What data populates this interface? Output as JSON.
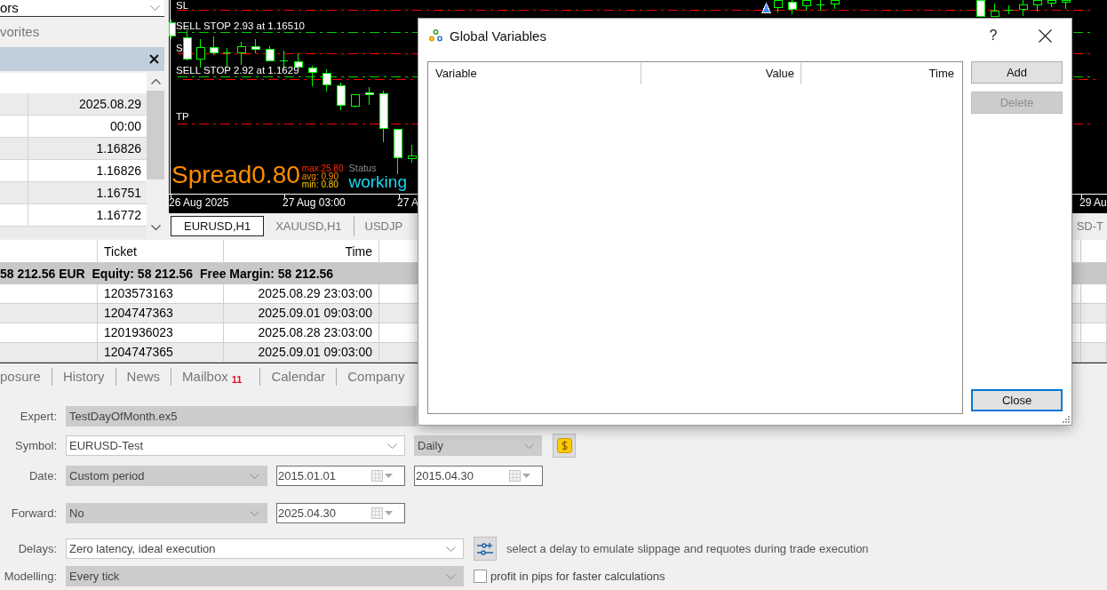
{
  "market_watch": {
    "dropdown": "ors",
    "tab": "vorites",
    "values": [
      "2025.08.29",
      "00:00",
      "1.16826",
      "1.16826",
      "1.16751",
      "1.16772"
    ]
  },
  "chart": {
    "levels": [
      {
        "label": "SL",
        "color": "#ff0000"
      },
      {
        "label": "SELL STOP 2.93 at 1.16510",
        "color": "#00d000"
      },
      {
        "label": "S",
        "color": "#ff0000"
      },
      {
        "label": "SELL STOP 2.92 at 1.1629",
        "color": "#00d000"
      },
      {
        "label": "TP",
        "color": "#ff0000"
      }
    ],
    "spread": {
      "label": "Spread",
      "value": "0.80",
      "max": "max:25.80",
      "avg": "avg: 0.90",
      "min": "min: 0.80",
      "status_label": "Status",
      "status": "working"
    },
    "time_axis": [
      "26 Aug 2025",
      "27 Aug 03:00",
      "27 A",
      "29 Au"
    ]
  },
  "chart_tabs": [
    {
      "label": "EURUSD,H1",
      "selected": true
    },
    {
      "label": "XAUUSD,H1",
      "selected": false
    },
    {
      "label": "USDJP",
      "selected": false
    },
    {
      "label": "SD-T",
      "selected": false
    }
  ],
  "trade_table": {
    "columns": [
      "Ticket",
      "Time"
    ],
    "summary": "58 212.56 EUR  Equity: 58 212.56  Free Margin: 58 212.56",
    "rows": [
      {
        "ticket": "1203573163",
        "time": "2025.08.29 23:03:00"
      },
      {
        "ticket": "1204747363",
        "time": "2025.09.01 09:03:00"
      },
      {
        "ticket": "1201936023",
        "time": "2025.08.28 23:03:00"
      },
      {
        "ticket": "1204747365",
        "time": "2025.09.01 09:03:00"
      }
    ]
  },
  "toolbox_tabs": [
    {
      "label": "posure",
      "selected": false
    },
    {
      "label": "History",
      "selected": false
    },
    {
      "label": "News",
      "selected": false
    },
    {
      "label": "Mailbox",
      "unread_count": "11",
      "selected": false
    },
    {
      "label": "Calendar",
      "selected": false
    },
    {
      "label": "Company",
      "selected": false
    }
  ],
  "tester": {
    "expert": {
      "label": "Expert:",
      "value": "TestDayOfMonth.ex5",
      "disabled": true
    },
    "symbol": {
      "label": "Symbol:",
      "value": "EURUSD-Test",
      "disabled": false
    },
    "period": {
      "value": "Daily",
      "disabled": true
    },
    "date": {
      "label": "Date:",
      "value": "Custom period",
      "disabled": true,
      "from": "2015.01.01",
      "to": "2015.04.30"
    },
    "forward": {
      "label": "Forward:",
      "value": "No",
      "disabled": true,
      "date": "2025.04.30"
    },
    "delays": {
      "label": "Delays:",
      "value": "Zero latency, ideal execution",
      "disabled": false,
      "hint": "select a delay to emulate slippage and requotes during trade execution"
    },
    "modelling": {
      "label": "Modelling:",
      "value": "Every tick",
      "disabled": true,
      "option": {
        "label": "profit in pips for faster calculations",
        "checked": false
      }
    }
  },
  "dialog": {
    "title": "Global Variables",
    "help": "?",
    "columns": [
      "Variable",
      "Value",
      "Time"
    ],
    "buttons": [
      {
        "label": "Add",
        "disabled": false,
        "default": false
      },
      {
        "label": "Delete",
        "disabled": true,
        "default": false
      },
      {
        "label": "Close",
        "disabled": false,
        "default": true
      }
    ]
  }
}
